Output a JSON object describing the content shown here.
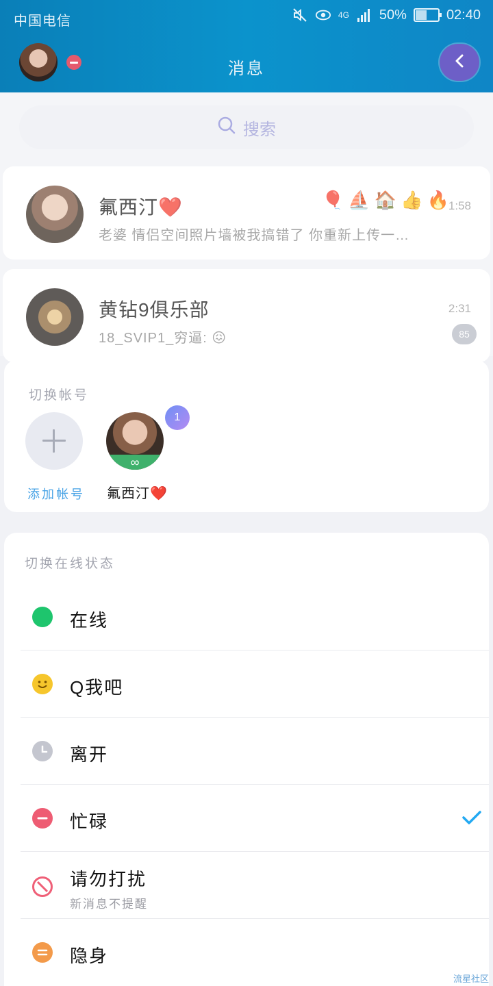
{
  "status_bar": {
    "carrier": "中国电信",
    "network": "4G",
    "battery": "50%",
    "battery_level": 0.5,
    "time": "02:40"
  },
  "header": {
    "title": "消息"
  },
  "search": {
    "placeholder": "搜索"
  },
  "chats": [
    {
      "name": "氟西汀❤️",
      "preview": "老婆  情侣空间照片墙被我搞错了  你重新上传一…",
      "time": "1:58",
      "icons": "🎈⛵🏠👍🔥"
    },
    {
      "name": "黄钻9俱乐部",
      "preview": "18_SVIP1_穷逼: 😖",
      "time": "2:31",
      "unread": "85"
    }
  ],
  "switch_account": {
    "title": "切换帐号",
    "add_label": "添加帐号",
    "current_badge": "1",
    "account_name": "氟西汀❤️",
    "band_symbol": "∞"
  },
  "online_status": {
    "title": "切换在线状态",
    "options": [
      {
        "label": "在线",
        "icon": "online-dot-icon",
        "color": "#1ec56d"
      },
      {
        "label": "Q我吧",
        "icon": "smiley-icon",
        "color": "#f6c62c"
      },
      {
        "label": "离开",
        "icon": "clock-icon",
        "color": "#c4c6cf"
      },
      {
        "label": "忙碌",
        "icon": "busy-minus-icon",
        "color": "#ee5c73",
        "selected": true
      },
      {
        "label": "请勿打扰",
        "sub": "新消息不提醒",
        "icon": "do-not-disturb-icon",
        "color": "#ef5f77"
      },
      {
        "label": "隐身",
        "icon": "invisible-icon",
        "color": "#f39a4a"
      }
    ]
  },
  "watermark": "流星社区"
}
